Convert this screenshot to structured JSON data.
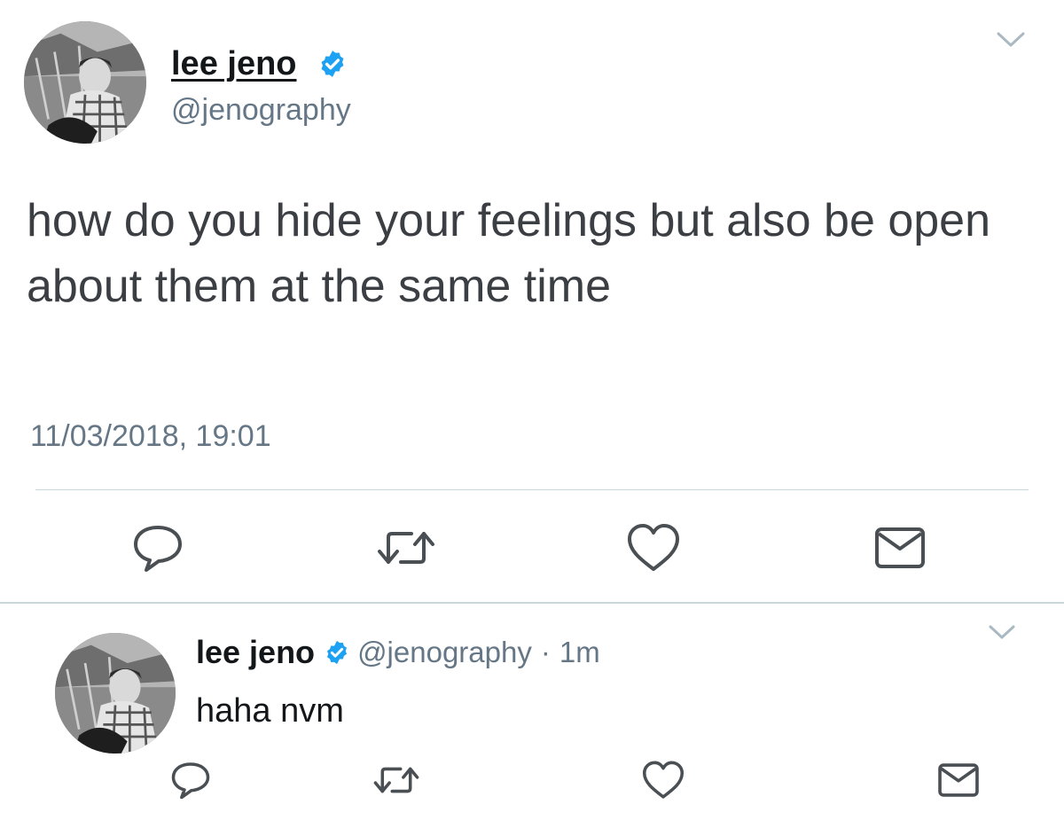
{
  "main_tweet": {
    "display_name": "lee jeno",
    "handle": "@jenography",
    "text": "how do you hide your feelings but also be open about them at the same time",
    "timestamp": "11/03/2018, 19:01",
    "verified": true,
    "actions": [
      "reply-icon",
      "retweet-icon",
      "like-icon",
      "direct-message-icon"
    ]
  },
  "reply_tweet": {
    "display_name": "lee jeno",
    "handle": "@jenography",
    "separator": "·",
    "time": "1m",
    "text": "haha nvm",
    "verified": true,
    "actions": [
      "reply-icon",
      "retweet-icon",
      "like-icon",
      "direct-message-icon"
    ]
  },
  "colors": {
    "verified_badge": "#1da1f2",
    "secondary_text": "#657786",
    "icon_gray": "#4a4f54",
    "divider": "#ccd6dd"
  }
}
